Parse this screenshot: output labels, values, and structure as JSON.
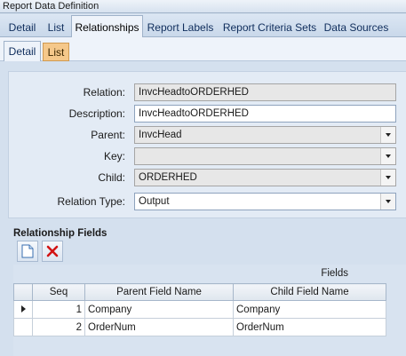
{
  "window": {
    "title": "Report Data Definition"
  },
  "main_tabs": [
    {
      "label": "Detail"
    },
    {
      "label": "List"
    },
    {
      "label": "Relationships"
    },
    {
      "label": "Report Labels"
    },
    {
      "label": "Report Criteria Sets"
    },
    {
      "label": "Data Sources"
    }
  ],
  "sub_tabs": [
    {
      "label": "Detail"
    },
    {
      "label": "List"
    }
  ],
  "form": {
    "relation": {
      "label": "Relation:",
      "value": "InvcHeadtoORDERHED"
    },
    "description": {
      "label": "Description:",
      "value": "InvcHeadtoORDERHED"
    },
    "parent": {
      "label": "Parent:",
      "value": "InvcHead"
    },
    "key": {
      "label": "Key:",
      "value": ""
    },
    "child": {
      "label": "Child:",
      "value": "ORDERHED"
    },
    "relation_type": {
      "label": "Relation Type:",
      "value": "Output"
    }
  },
  "relationship_fields": {
    "title": "Relationship Fields",
    "group_header": "Fields",
    "columns": [
      "Seq",
      "Parent Field Name",
      "Child Field Name"
    ],
    "rows": [
      {
        "seq": "1",
        "parent": "Company",
        "child": "Company"
      },
      {
        "seq": "2",
        "parent": "OrderNum",
        "child": "OrderNum"
      }
    ]
  },
  "icons": {
    "new": "new-document-icon",
    "delete": "delete-x-icon",
    "row_pointer": "row-pointer-icon",
    "dropdown": "chevron-down-icon"
  },
  "colors": {
    "accent_tab": "#f5c88a",
    "delete_red": "#d21414",
    "panel": "#e3ebf5"
  }
}
